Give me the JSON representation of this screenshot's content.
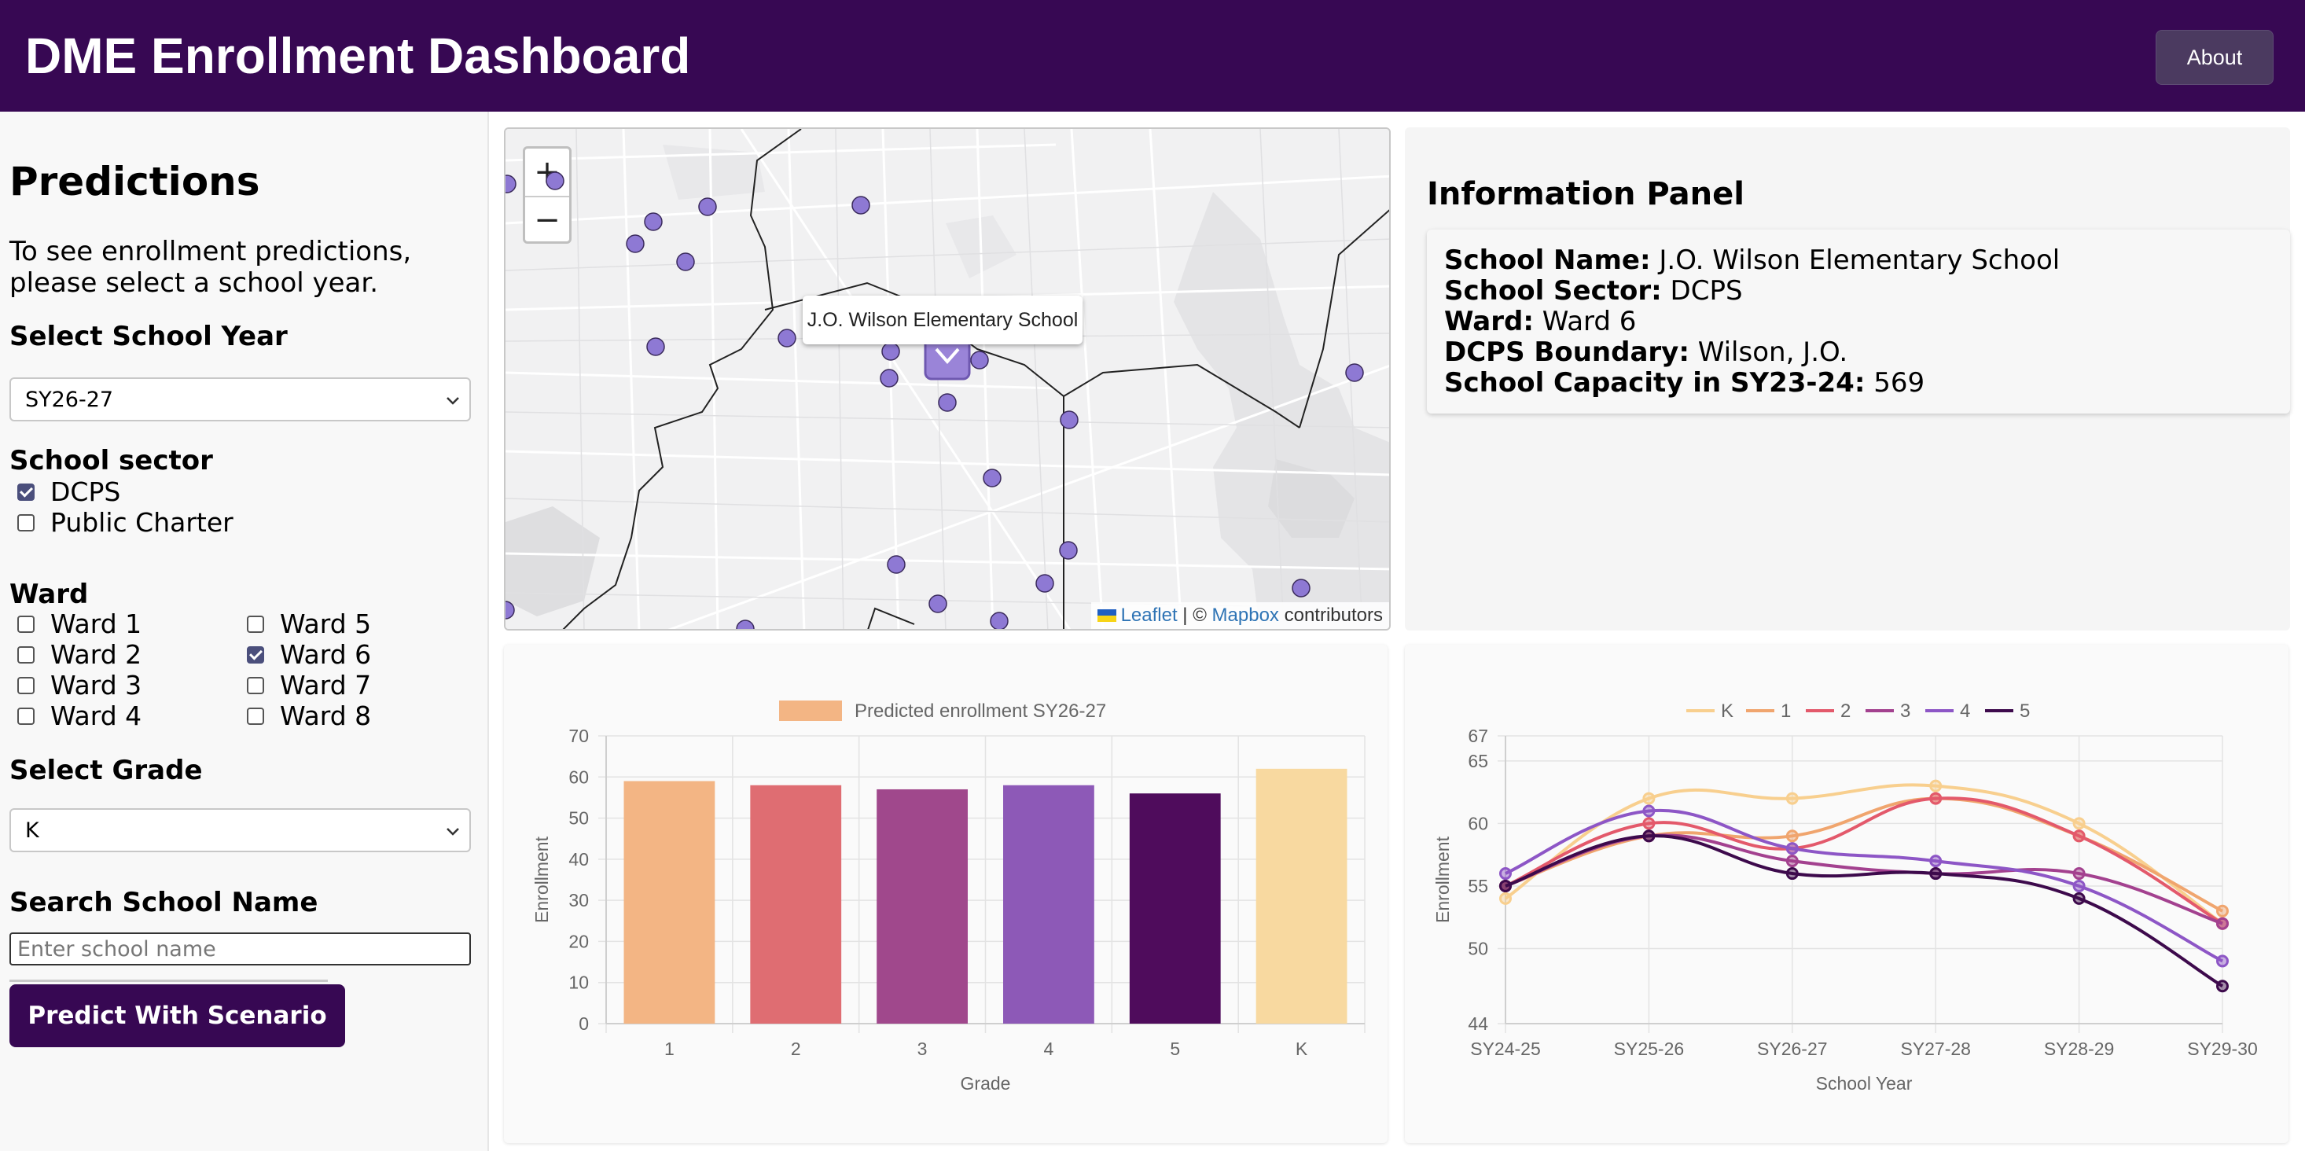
{
  "header": {
    "title": "DME Enrollment Dashboard",
    "about_label": "About"
  },
  "sidebar": {
    "title": "Predictions",
    "intro": "To see enrollment predictions, please select a school year.",
    "school_year": {
      "label": "Select School Year",
      "value": "SY26-27"
    },
    "sector": {
      "label": "School sector",
      "options": [
        {
          "label": "DCPS",
          "checked": true
        },
        {
          "label": "Public Charter",
          "checked": false
        }
      ]
    },
    "ward": {
      "label": "Ward",
      "options": [
        {
          "label": "Ward 1",
          "checked": false
        },
        {
          "label": "Ward 2",
          "checked": false
        },
        {
          "label": "Ward 3",
          "checked": false
        },
        {
          "label": "Ward 4",
          "checked": false
        },
        {
          "label": "Ward 5",
          "checked": false
        },
        {
          "label": "Ward 6",
          "checked": true
        },
        {
          "label": "Ward 7",
          "checked": false
        },
        {
          "label": "Ward 8",
          "checked": false
        }
      ]
    },
    "grade": {
      "label": "Select Grade",
      "value": "K"
    },
    "search": {
      "label": "Search School Name",
      "placeholder": "Enter school name",
      "value": ""
    },
    "predict_button": "Predict With Scenario"
  },
  "map": {
    "zoom_in": "+",
    "zoom_out": "−",
    "popup": "J.O. Wilson Elementary School",
    "attribution": {
      "leaflet": "Leaflet",
      "sep": " | © ",
      "mapbox": "Mapbox",
      "suffix": " contributors"
    },
    "marker_color": "#8e79d4",
    "selected_marker_color": "#7a5fd0"
  },
  "info_panel": {
    "title": "Information Panel",
    "fields": [
      {
        "label": "School Name:",
        "value": "J.O. Wilson Elementary School"
      },
      {
        "label": "School Sector:",
        "value": "DCPS"
      },
      {
        "label": "Ward:",
        "value": "Ward 6"
      },
      {
        "label": "DCPS Boundary:",
        "value": "Wilson, J.O."
      },
      {
        "label": "School Capacity in SY23-24:",
        "value": "569"
      }
    ]
  },
  "chart_data": [
    {
      "type": "bar",
      "legend": [
        "Predicted enrollment SY26-27"
      ],
      "categories": [
        "1",
        "2",
        "3",
        "4",
        "5",
        "K"
      ],
      "values": [
        59,
        58,
        57,
        58,
        56,
        62
      ],
      "colors": [
        "#f3b584",
        "#df6d72",
        "#a0488c",
        "#8d59b7",
        "#4f0c5c",
        "#f8d9a0"
      ],
      "legend_color": "#f3b584",
      "xlabel": "Grade",
      "ylabel": "Enrollment",
      "ylim": [
        0,
        70
      ],
      "yticks": [
        0,
        10,
        20,
        30,
        40,
        50,
        60,
        70
      ],
      "grid": true
    },
    {
      "type": "line",
      "x": [
        "SY24-25",
        "SY25-26",
        "SY26-27",
        "SY27-28",
        "SY28-29",
        "SY29-30"
      ],
      "series": [
        {
          "name": "K",
          "color": "#f8cf8e",
          "values": [
            54,
            62,
            62,
            63,
            60,
            52
          ]
        },
        {
          "name": "1",
          "color": "#f0a56e",
          "values": [
            55,
            59,
            59,
            62,
            59,
            53
          ]
        },
        {
          "name": "2",
          "color": "#e3596b",
          "values": [
            55,
            60,
            58,
            62,
            59,
            52
          ]
        },
        {
          "name": "3",
          "color": "#a3418f",
          "values": [
            55,
            59,
            57,
            56,
            56,
            52
          ]
        },
        {
          "name": "4",
          "color": "#8d56c6",
          "values": [
            56,
            61,
            58,
            57,
            55,
            49
          ]
        },
        {
          "name": "5",
          "color": "#3d0a4c",
          "values": [
            55,
            59,
            56,
            56,
            54,
            47
          ]
        }
      ],
      "xlabel": "School Year",
      "ylabel": "Enrollment",
      "ylim": [
        44,
        67
      ],
      "yticks": [
        44,
        50,
        55,
        60,
        65,
        67
      ],
      "legend_position": "top",
      "grid": true
    }
  ]
}
